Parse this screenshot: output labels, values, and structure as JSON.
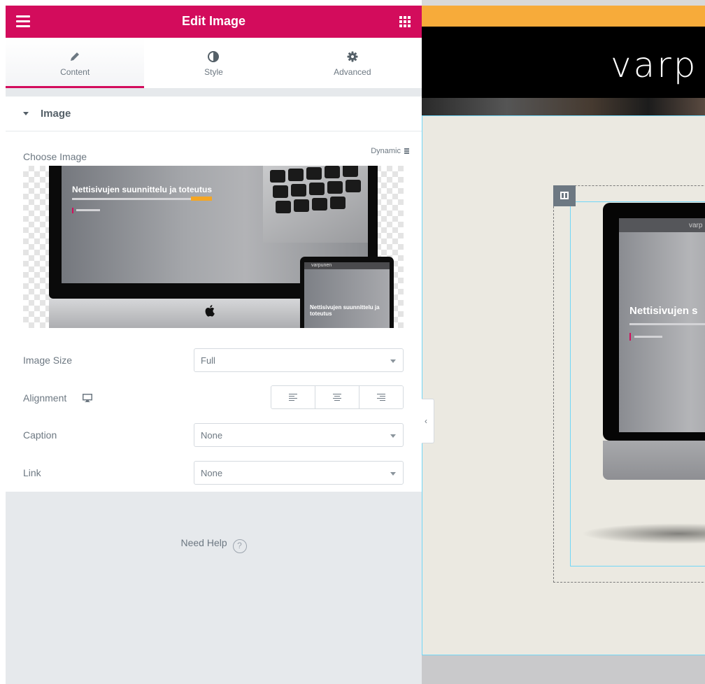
{
  "panel": {
    "title": "Edit Image",
    "tabs": [
      {
        "label": "Content",
        "icon": "pencil-icon",
        "active": true
      },
      {
        "label": "Style",
        "icon": "half-circle-icon",
        "active": false
      },
      {
        "label": "Advanced",
        "icon": "gear-icon",
        "active": false
      }
    ],
    "section_title": "Image",
    "choose_image_label": "Choose Image",
    "dynamic_label": "Dynamic",
    "image_size_label": "Image Size",
    "image_size_value": "Full",
    "alignment_label": "Alignment",
    "caption_label": "Caption",
    "caption_value": "None",
    "link_label": "Link",
    "link_value": "None",
    "need_help_label": "Need Help",
    "help_icon_glyph": "?",
    "accent_color": "#d30c5c"
  },
  "image_preview": {
    "headline": "Nettisivujen suunnittelu ja toteutus",
    "tablet_brand": "varpunen",
    "tablet_headline": "Nettisivujen suunnittelu ja toteutus"
  },
  "preview": {
    "logo_text": "varp",
    "monitor_brand": "varp",
    "monitor_headline": "Nettisivujen s",
    "collapse_glyph": "‹",
    "topbar_color": "#f7ab3a"
  }
}
